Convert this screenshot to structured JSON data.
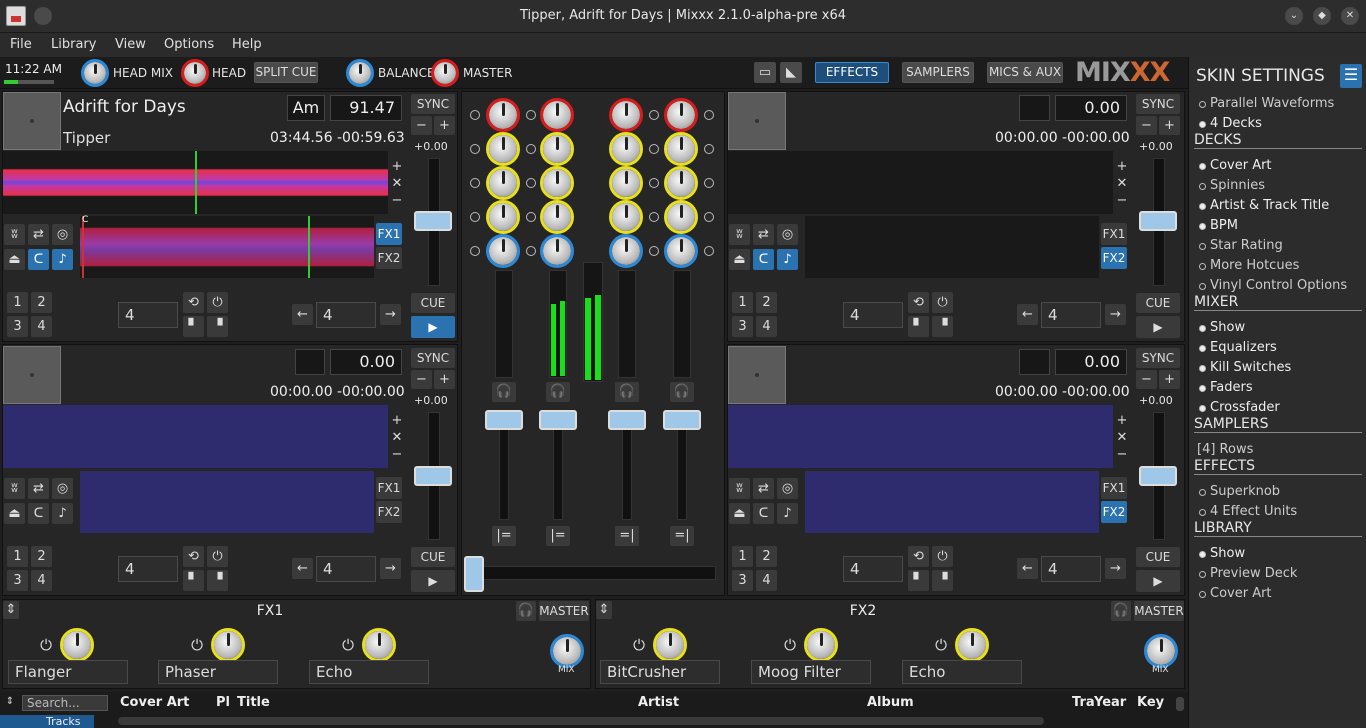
{
  "window": {
    "title": "Tipper, Adrift for Days | Mixxx 2.1.0-alpha-pre x64",
    "min": "⌄",
    "max": "◆",
    "close": "✕"
  },
  "menu": [
    "File",
    "Library",
    "View",
    "Options",
    "Help"
  ],
  "topbar": {
    "clock": "11:22 AM",
    "head_mix": "HEAD MIX",
    "head": "HEAD",
    "split_cue": "SPLIT CUE",
    "balance": "BALANCE",
    "master": "MASTER",
    "effects": "EFFECTS",
    "samplers": "SAMPLERS",
    "mics_aux": "MICS & AUX",
    "logo_a": "MIX",
    "logo_b": "XX"
  },
  "deck1": {
    "title": "Adrift for Days",
    "key": "Am",
    "bpm": "91.47",
    "artist": "Tipper",
    "elapsed": "03:44.56",
    "remaining": "-00:59.63",
    "rate": "+0.00",
    "loop1": "4",
    "loop2": "4",
    "sync": "SYNC",
    "cue": "CUE",
    "fx1": "FX1",
    "fx2": "FX2"
  },
  "deck2": {
    "bpm": "0.00",
    "elapsed": "00:00.00",
    "remaining": "-00:00.00",
    "rate": "+0.00",
    "loop1": "4",
    "loop2": "4",
    "sync": "SYNC",
    "cue": "CUE",
    "fx1": "FX1",
    "fx2": "FX2"
  },
  "deck3": {
    "bpm": "0.00",
    "elapsed": "00:00.00",
    "remaining": "-00:00.00",
    "rate": "+0.00",
    "loop1": "4",
    "loop2": "4",
    "sync": "SYNC",
    "cue": "CUE",
    "fx1": "FX1",
    "fx2": "FX2"
  },
  "deck4": {
    "bpm": "0.00",
    "elapsed": "00:00.00",
    "remaining": "-00:00.00",
    "rate": "+0.00",
    "loop1": "4",
    "loop2": "4",
    "sync": "SYNC",
    "cue": "CUE",
    "fx1": "FX1",
    "fx2": "FX2"
  },
  "hotcues": [
    "1",
    "2",
    "3",
    "4"
  ],
  "marks": {
    "plus": "+",
    "minus": "−",
    "cross": "✕",
    "cue_c": "C"
  },
  "fx_units": [
    {
      "title": "FX1",
      "master": "MASTER",
      "mix": "MIX",
      "effects": [
        "Flanger",
        "Phaser",
        "Echo"
      ]
    },
    {
      "title": "FX2",
      "master": "MASTER",
      "mix": "MIX",
      "effects": [
        "BitCrusher",
        "Moog Filter",
        "Echo"
      ]
    }
  ],
  "sidebar": {
    "title": "SKIN SETTINGS",
    "top": [
      {
        "label": "Parallel Waveforms",
        "on": false
      },
      {
        "label": "4 Decks",
        "on": true
      }
    ],
    "decks_h": "DECKS",
    "decks": [
      {
        "label": "Cover Art",
        "on": true
      },
      {
        "label": "Spinnies",
        "on": false
      },
      {
        "label": "Artist & Track Title",
        "on": true
      },
      {
        "label": "BPM",
        "on": true
      },
      {
        "label": "Star Rating",
        "on": false
      },
      {
        "label": "More Hotcues",
        "on": false
      },
      {
        "label": "Vinyl Control Options",
        "on": false
      }
    ],
    "mixer_h": "MIXER",
    "mixer": [
      {
        "label": "Show",
        "on": true
      },
      {
        "label": "Equalizers",
        "on": true
      },
      {
        "label": "Kill Switches",
        "on": true
      },
      {
        "label": "Faders",
        "on": true
      },
      {
        "label": "Crossfader",
        "on": true
      }
    ],
    "samplers_h": "SAMPLERS",
    "samplers_rows": "[4] Rows",
    "effects_h": "EFFECTS",
    "effects": [
      {
        "label": "Superknob",
        "on": false
      },
      {
        "label": "4 Effect Units",
        "on": false
      }
    ],
    "library_h": "LIBRARY",
    "library": [
      {
        "label": "Show",
        "on": true
      },
      {
        "label": "Preview Deck",
        "on": false
      },
      {
        "label": "Cover Art",
        "on": false
      }
    ]
  },
  "library": {
    "search_placeholder": "Search...",
    "tree_item": "Tracks",
    "columns": [
      "Cover Art",
      "Pl",
      "Title",
      "Artist",
      "Album",
      "Tra",
      "Year",
      "Key"
    ]
  },
  "colors": {
    "accent": "#2a72b0",
    "eq_high": "#d81c1c",
    "eq_mid": "#e8e01c",
    "eq_low": "#2a8ad8",
    "vu": "#18e018",
    "wave_idle": "#2e2b6e"
  }
}
